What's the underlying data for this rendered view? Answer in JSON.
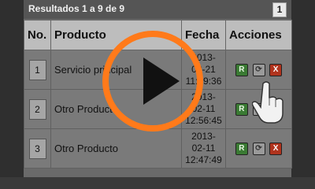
{
  "results_header": {
    "summary": "Resultados 1 a 9 de 9",
    "page_number": "1"
  },
  "table": {
    "columns": [
      "No.",
      "Producto",
      "Fecha",
      "Acciones"
    ],
    "rows": [
      {
        "num": "1",
        "producto": "Servicio principal",
        "fecha": [
          "2013-",
          "02-21",
          "11:09:36"
        ]
      },
      {
        "num": "2",
        "producto": "Otro Producto",
        "fecha": [
          "2013-",
          "02-11",
          "12:56:45"
        ]
      },
      {
        "num": "3",
        "producto": "Otro Producto",
        "fecha": [
          "2013-",
          "02-11",
          "12:47:49"
        ]
      }
    ],
    "action_labels": {
      "renew": "R",
      "refresh": "⟳",
      "delete": "X"
    }
  },
  "colors": {
    "play_ring": "#ff7a1a",
    "renew_btn": "#3a7a33",
    "delete_btn": "#b0331d"
  },
  "icons": {
    "play": "play-icon",
    "cursor": "hand-pointer-icon"
  }
}
